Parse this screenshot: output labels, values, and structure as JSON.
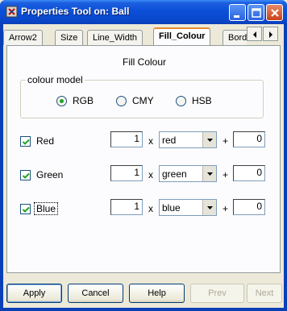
{
  "window": {
    "title": "Properties Tool on: Ball",
    "icon": "app-icon"
  },
  "tabs": [
    {
      "label": "Arrow2"
    },
    {
      "label": "Size"
    },
    {
      "label": "Line_Width"
    },
    {
      "label": "Fill_Colour",
      "active": true
    },
    {
      "label": "Bord"
    }
  ],
  "panel": {
    "title": "Fill Colour",
    "colour_model": {
      "legend": "colour model",
      "options": [
        "RGB",
        "CMY",
        "HSB"
      ],
      "selected": "RGB"
    },
    "channels": [
      {
        "label": "Red",
        "checked": true,
        "factor": "1",
        "select": "red",
        "offset": "0"
      },
      {
        "label": "Green",
        "checked": true,
        "factor": "1",
        "select": "green",
        "offset": "0"
      },
      {
        "label": "Blue",
        "checked": true,
        "factor": "1",
        "select": "blue",
        "offset": "0"
      }
    ],
    "mult_symbol": "x",
    "plus_symbol": "+"
  },
  "buttons": {
    "apply": "Apply",
    "cancel": "Cancel",
    "help": "Help",
    "prev": "Prev",
    "next": "Next"
  },
  "colors": {
    "titlebar": "#0b4fd8",
    "radio_checked": "#21a121",
    "active_tab_accent": "#e68b2c"
  }
}
